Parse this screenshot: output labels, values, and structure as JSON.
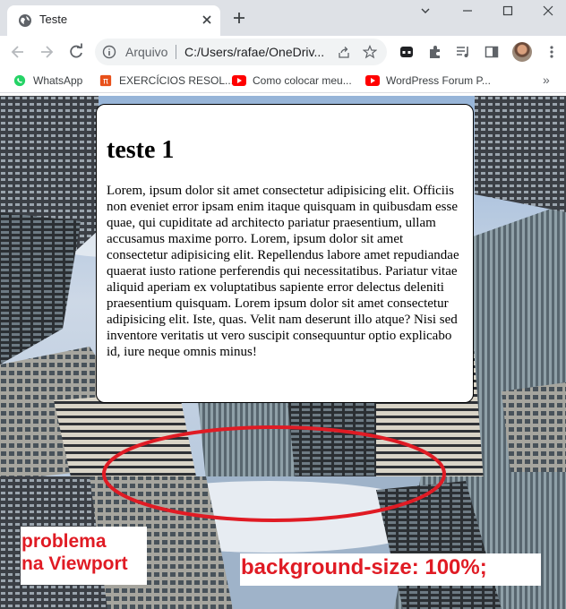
{
  "browser": {
    "tab": {
      "title": "Teste"
    },
    "omnibox": {
      "scheme": "Arquivo",
      "url": "C:/Users/rafae/OneDriv..."
    },
    "bookmarks": [
      {
        "label": "WhatsApp",
        "icon": "whatsapp-icon",
        "color": "#25d366"
      },
      {
        "label": "EXERCÍCIOS RESOL...",
        "icon": "pi-icon",
        "color": "#e8501a"
      },
      {
        "label": "Como colocar meu...",
        "icon": "youtube-icon",
        "color": "#ff0000"
      },
      {
        "label": "WordPress Forum P...",
        "icon": "youtube-icon",
        "color": "#ff0000"
      }
    ],
    "more_bookmarks": "»"
  },
  "page": {
    "heading": "teste 1",
    "paragraph": "Lorem, ipsum dolor sit amet consectetur adipisicing elit. Officiis non eveniet error ipsam enim itaque quisquam in quibusdam esse quae, qui cupiditate ad architecto pariatur praesentium, ullam accusamus maxime porro. Lorem, ipsum dolor sit amet consectetur adipisicing elit. Repellendus labore amet repudiandae quaerat iusto ratione perferendis qui necessitatibus. Pariatur vitae aliquid aperiam ex voluptatibus sapiente error delectus deleniti praesentium quisquam. Lorem ipsum dolor sit amet consectetur adipisicing elit. Iste, quas. Velit nam deserunt illo atque? Nisi sed inventore veritatis ut vero suscipit consequuntur optio explicabo id, iure neque omnis minus!"
  },
  "annotations": {
    "left_line1": "problema",
    "left_line2": "na Viewport",
    "right": "background-size: 100%;",
    "color": "#e01b24"
  }
}
